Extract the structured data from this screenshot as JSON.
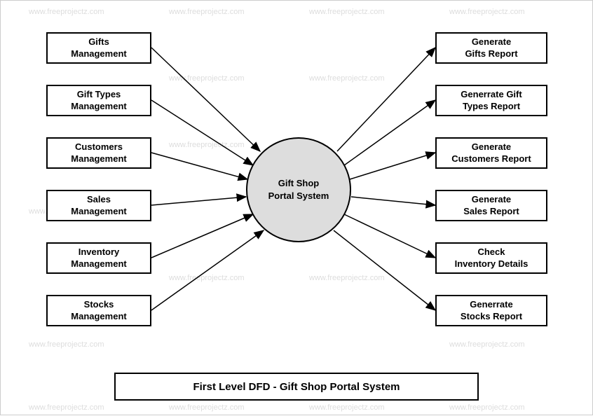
{
  "watermark": "www.freeprojectz.com",
  "center": {
    "label": "Gift Shop\nPortal System"
  },
  "leftBoxes": [
    {
      "label": "Gifts\nManagement"
    },
    {
      "label": "Gift Types\nManagement"
    },
    {
      "label": "Customers\nManagement"
    },
    {
      "label": "Sales\nManagement"
    },
    {
      "label": "Inventory\nManagement"
    },
    {
      "label": "Stocks\nManagement"
    }
  ],
  "rightBoxes": [
    {
      "label": "Generate\nGifts Report"
    },
    {
      "label": "Generrate Gift\nTypes Report"
    },
    {
      "label": "Generate\nCustomers Report"
    },
    {
      "label": "Generate\nSales Report"
    },
    {
      "label": "Check\nInventory Details"
    },
    {
      "label": "Generrate\nStocks Report"
    }
  ],
  "title": "First Level DFD - Gift Shop Portal System",
  "chart_data": {
    "type": "dfd",
    "level": "first",
    "system_name": "Gift Shop Portal System",
    "central_process": "Gift Shop Portal System",
    "inputs": [
      "Gifts Management",
      "Gift Types Management",
      "Customers Management",
      "Sales Management",
      "Inventory Management",
      "Stocks Management"
    ],
    "outputs": [
      "Generate Gifts Report",
      "Generrate Gift Types Report",
      "Generate Customers Report",
      "Generate Sales Report",
      "Check Inventory Details",
      "Generrate Stocks Report"
    ]
  }
}
